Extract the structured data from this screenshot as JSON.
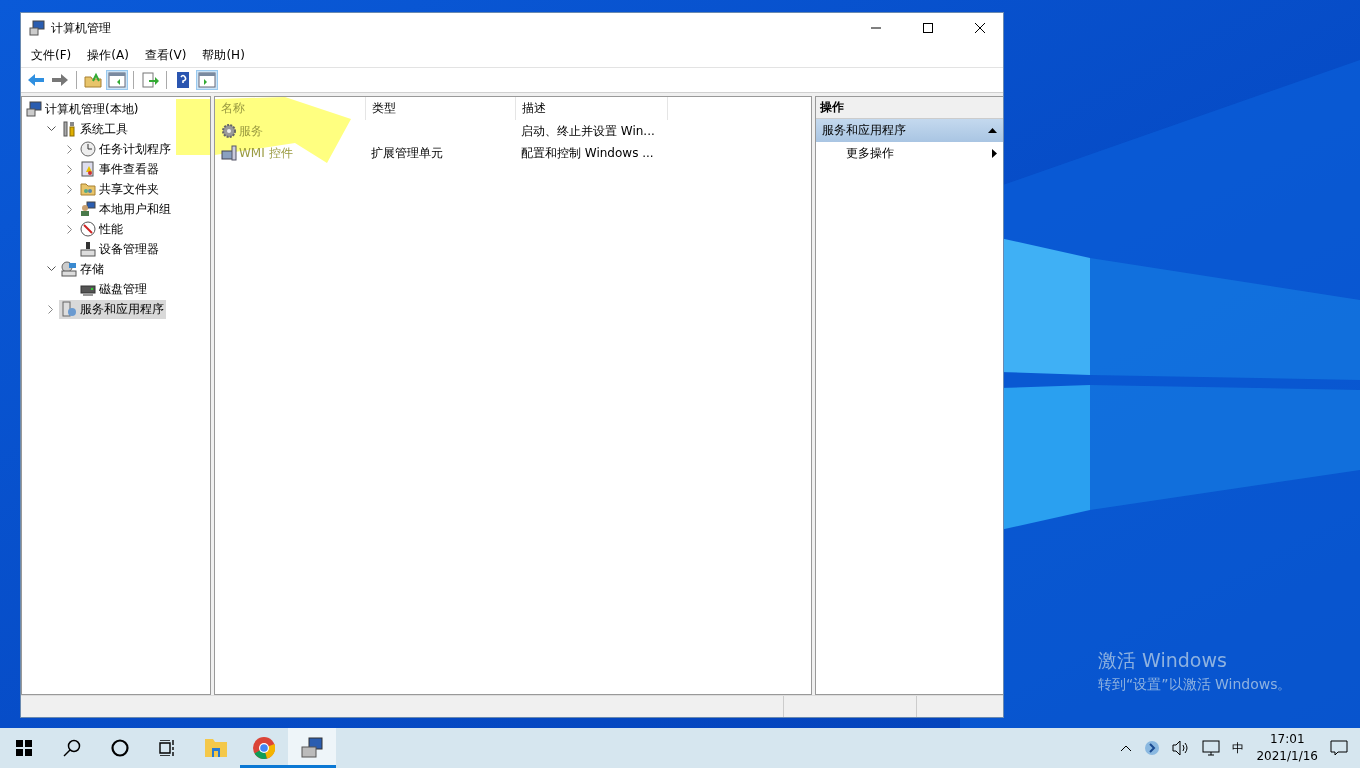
{
  "window": {
    "title": "计算机管理",
    "menu": [
      "文件(F)",
      "操作(A)",
      "查看(V)",
      "帮助(H)"
    ],
    "toolbar": [
      {
        "kind": "back",
        "selected": false
      },
      {
        "kind": "forward",
        "selected": false
      },
      {
        "kind": "separator"
      },
      {
        "kind": "up",
        "selected": false
      },
      {
        "kind": "console-tree",
        "selected": true
      },
      {
        "kind": "separator"
      },
      {
        "kind": "export",
        "selected": false
      },
      {
        "kind": "separator"
      },
      {
        "kind": "help",
        "selected": false
      },
      {
        "kind": "action-pane",
        "selected": true
      }
    ]
  },
  "tree": {
    "items": [
      {
        "label": "计算机管理(本地)",
        "kind": "computer",
        "selected": false,
        "children": [
          {
            "label": "系统工具",
            "kind": "tools",
            "expanded": true,
            "selected": false,
            "children": [
              {
                "label": "任务计划程序",
                "kind": "clock",
                "expanded": false,
                "selected": false
              },
              {
                "label": "事件查看器",
                "kind": "log",
                "expanded": false,
                "selected": false
              },
              {
                "label": "共享文件夹",
                "kind": "folder",
                "expanded": false,
                "selected": false
              },
              {
                "label": "本地用户和组",
                "kind": "users",
                "expanded": false,
                "selected": false
              },
              {
                "label": "性能",
                "kind": "gauge",
                "expanded": false,
                "selected": false
              },
              {
                "label": "设备管理器",
                "kind": "device",
                "selected": false
              }
            ]
          },
          {
            "label": "存储",
            "kind": "storage",
            "expanded": true,
            "selected": false,
            "children": [
              {
                "label": "磁盘管理",
                "kind": "disk",
                "selected": false
              }
            ]
          },
          {
            "label": "服务和应用程序",
            "kind": "server",
            "expanded": false,
            "selected": true
          }
        ]
      }
    ]
  },
  "list": {
    "columns": [
      "名称",
      "类型",
      "描述"
    ],
    "rows": [
      {
        "name": "服务",
        "kind": "gear",
        "description": "启动、终止并设置 Win..."
      },
      {
        "name": "WMI 控件",
        "kind": "wmi",
        "type": "扩展管理单元",
        "description": "配置和控制 Windows ..."
      }
    ]
  },
  "actions": {
    "title": "操作",
    "sections": [
      {
        "label": "服务和应用程序",
        "expanded": true,
        "items": [
          "更多操作"
        ]
      }
    ]
  },
  "activation": {
    "title": "激活 Windows",
    "text": "转到“设置”以激活 Windows。"
  },
  "taskbar": {
    "apps": [
      {
        "kind": "start",
        "running": false,
        "selected": false
      },
      {
        "kind": "search",
        "running": false,
        "selected": false
      },
      {
        "kind": "cortana",
        "running": false,
        "selected": false
      },
      {
        "kind": "task-view",
        "running": false,
        "selected": false
      },
      {
        "kind": "explorer",
        "running": false,
        "selected": false
      },
      {
        "kind": "chrome",
        "running": true,
        "selected": false
      },
      {
        "kind": "mmc",
        "running": true,
        "selected": true
      }
    ],
    "tray": {
      "ime": "中",
      "time": "17:01",
      "date": "2021/1/16"
    }
  }
}
